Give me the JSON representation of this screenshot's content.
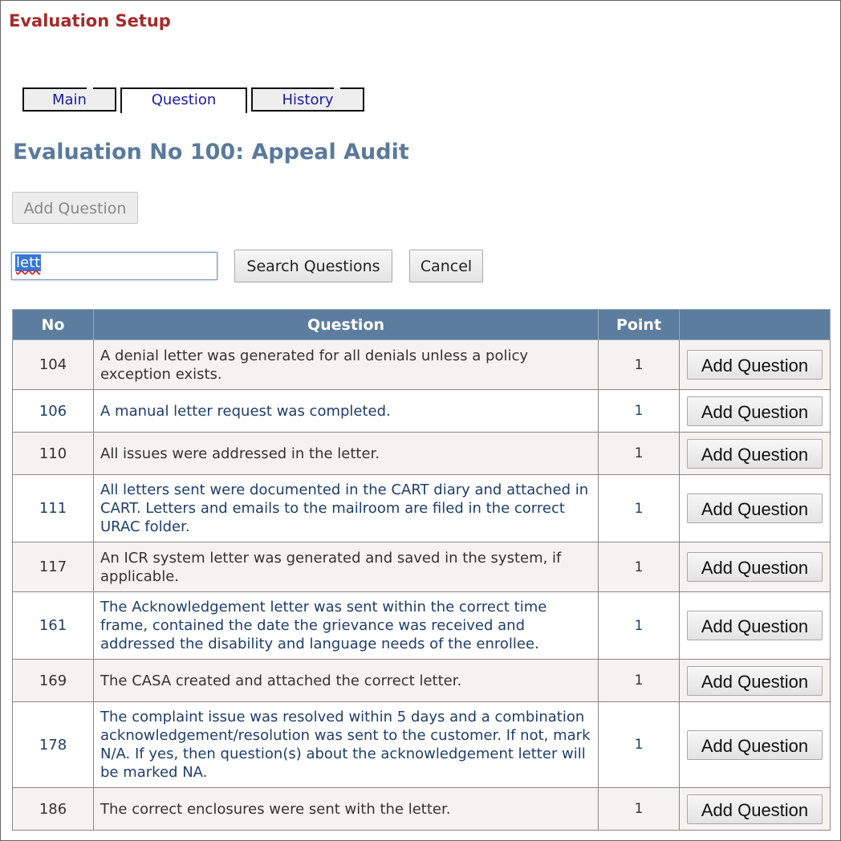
{
  "page_title": "Evaluation Setup",
  "tabs": [
    {
      "label": "Main",
      "active": false
    },
    {
      "label": "Question",
      "active": true
    },
    {
      "label": "History",
      "active": false
    }
  ],
  "heading": "Evaluation No 100: Appeal Audit",
  "add_question_button": "Add Question",
  "search": {
    "value": "lett"
  },
  "search_button": "Search Questions",
  "cancel_button": "Cancel",
  "table": {
    "headers": [
      "No",
      "Question",
      "Point",
      ""
    ],
    "row_button_label": "Add Question",
    "rows": [
      {
        "no": "104",
        "question": "A denial letter was generated for all denials unless a policy exception exists.",
        "point": "1"
      },
      {
        "no": "106",
        "question": "A manual letter request was completed.",
        "point": "1"
      },
      {
        "no": "110",
        "question": "All issues were addressed in the letter.",
        "point": "1"
      },
      {
        "no": "111",
        "question": "All letters sent were documented in the CART diary and attached in CART. Letters and emails to the mailroom are filed in the correct URAC folder.",
        "point": "1"
      },
      {
        "no": "117",
        "question": "An ICR system letter was generated and saved in the system, if applicable.",
        "point": "1"
      },
      {
        "no": "161",
        "question": "The Acknowledgement letter was sent within the correct time frame, contained the date the grievance was received and addressed the disability and language needs of the enrollee.",
        "point": "1"
      },
      {
        "no": "169",
        "question": "The CASA created and attached the correct letter.",
        "point": "1"
      },
      {
        "no": "178",
        "question": "The complaint issue was resolved within 5 days and a combination acknowledgement/resolution was sent to the customer. If not, mark N/A. If yes, then question(s) about the acknowledgement letter will be marked NA.",
        "point": "1"
      },
      {
        "no": "186",
        "question": "The correct enclosures were sent with the letter.",
        "point": "1"
      }
    ]
  }
}
